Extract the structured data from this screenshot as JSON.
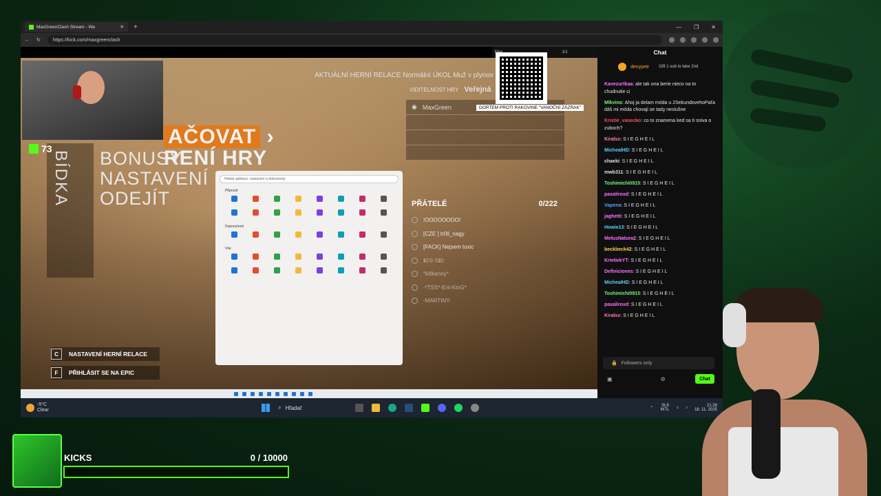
{
  "browser": {
    "tab_title": "MaxGreenClash Stream - Wa",
    "url": "https://kick.com/maxgreenclash"
  },
  "stream_overlay": {
    "kick_counter": "73",
    "menu_big": [
      "AČOVAT",
      "RENÍ HRY"
    ],
    "menu_items": [
      "BONUSY",
      "NASTAVENÍ",
      "ODEJÍT"
    ],
    "vertical_label": "BÍDKA",
    "session_line": "AKTUÁLNÍ HERNÍ RELACE  Normální  ÚKOL  Muž v plynov",
    "visibility_label": "VIDITELNOST HRY",
    "visibility_value": "Veřejná",
    "player_name": "MaxGreen",
    "friends_title": "PŘÁTELÉ",
    "friends_count": "0/222",
    "friends": [
      "!OOOOOOOO!",
      "[CZE ] tr0ll_nagy",
      "[FACK] Nejsem toxic",
      "ℹ︎0'0-'0ℹ︎0",
      "*killkenny*",
      "-*TSS*-Ent-KinG*",
      "-MARTINY-"
    ],
    "btn_session": "NASTAVENÍ HERNÍ RELACE",
    "btn_session_key": "C",
    "btn_epic": "PŘIHLÁSIT SE NA EPIC",
    "btn_epic_key": "F",
    "qr_caption": "DORTEM PROTI RAKOVINE \"VANOČNÍ ZÁZRAK\"",
    "max_label": "Max",
    "page_count": "1/1"
  },
  "start_menu": {
    "search_placeholder": "Hledat aplikace, nastavení a dokumenty",
    "pinned_label": "Připnuté",
    "recommended_label": "Doporučené",
    "all_label": "Vše"
  },
  "chat": {
    "title": "Chat",
    "pinned_user": "denypetr",
    "pinned_text": "Gift 1 sub to take 2nd",
    "messages": [
      {
        "user": "Kavezurtkaa",
        "color": "#ff72ff",
        "text": "ale tak ona berie nieco na to chudnutie ci"
      },
      {
        "user": "Mlkvino",
        "color": "#7cf27c",
        "text": "Ahoj ja delam móda u 2SekundovehoPaťa dáš mi móda chovaji se tady neslušne"
      },
      {
        "user": "Kristie_vasecko",
        "color": "#ff5252",
        "text": "co to znamena ked sa ti sniva o zuboch?"
      },
      {
        "user": "Kiralsx",
        "color": "#ff80c0",
        "text": "S I E G H E I L"
      },
      {
        "user": "MichealHD",
        "color": "#5ad2ff",
        "text": "S I E G H E I L"
      },
      {
        "user": "chaeki",
        "color": "#e0e0e0",
        "text": "S I E G H E I L"
      },
      {
        "user": "mwb311",
        "color": "#e0e0e0",
        "text": "S I E G H E I L"
      },
      {
        "user": "Toshimichi0915",
        "color": "#7cf27c",
        "text": "S I E G H E I L"
      },
      {
        "user": "paxaliroxd",
        "color": "#ff72ff",
        "text": "S I E G H E I L"
      },
      {
        "user": "Vapena",
        "color": "#5a9bff",
        "text": "S I E G H E I L"
      },
      {
        "user": "jaghetti",
        "color": "#ff72ff",
        "text": "S I E G H E I L"
      },
      {
        "user": "Howie13",
        "color": "#5ad2ff",
        "text": "S I E G H E I L"
      },
      {
        "user": "MelusNatura2",
        "color": "#ff72ff",
        "text": "S I E G H E I L"
      },
      {
        "user": "beckbeck42",
        "color": "#ffd24a",
        "text": "S I E G H E I L"
      },
      {
        "user": "KrietiekYT",
        "color": "#ff72ff",
        "text": "S I E G H E I L"
      },
      {
        "user": "Definiciones",
        "color": "#ff72ff",
        "text": "S I E G H E I L"
      },
      {
        "user": "MichealHD",
        "color": "#5ad2ff",
        "text": "S I E G H E I L"
      },
      {
        "user": "Toshimichi0915",
        "color": "#7cf27c",
        "text": "S I E G H E I L"
      },
      {
        "user": "paxaliroxd",
        "color": "#ff72ff",
        "text": "S I E G H E I L"
      },
      {
        "user": "Kiralsx",
        "color": "#ff80c0",
        "text": "S I E G H E I L"
      }
    ],
    "input_placeholder": "Followers only",
    "send_label": "Chat"
  },
  "taskbar": {
    "temp": "-5°C",
    "weather": "Clear",
    "search_label": "Hľadať",
    "lang": "SLK",
    "lang2": "INTL",
    "time": "21:28",
    "date": "18. 11. 2025"
  },
  "kicks": {
    "label": "KICKS",
    "count": "0  / 10000",
    "progress": 0
  }
}
